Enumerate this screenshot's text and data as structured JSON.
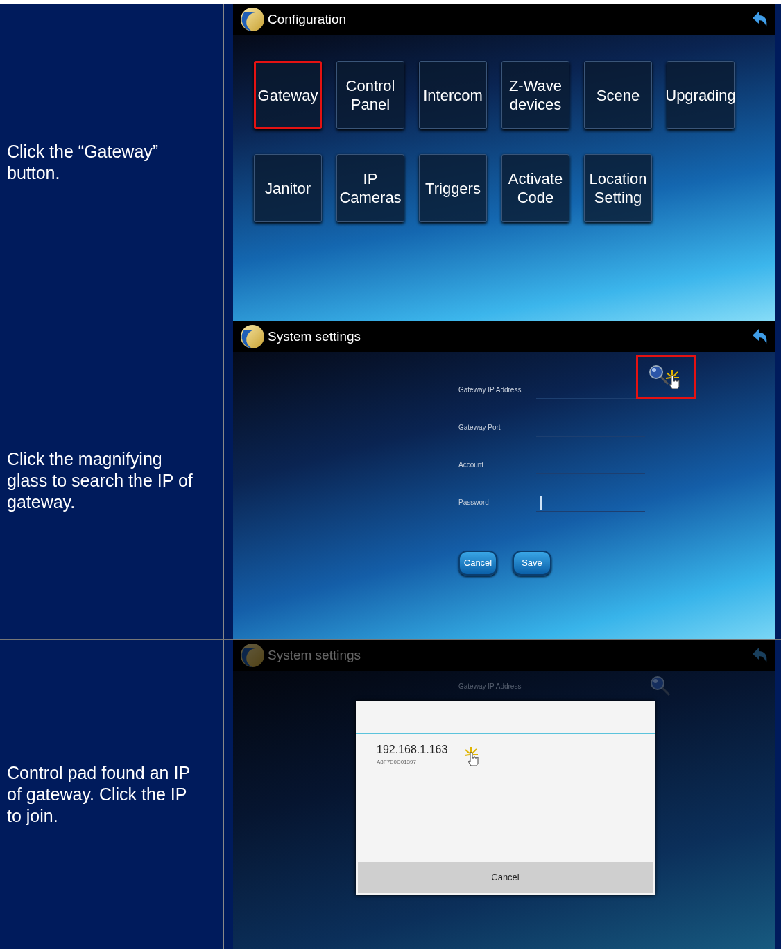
{
  "steps": [
    {
      "instruction": "Click the “Gateway” button.",
      "screen": {
        "kind": "configuration",
        "title": "Configuration",
        "dimmed": false,
        "tiles": [
          {
            "label": "Gateway",
            "highlighted": true
          },
          {
            "label": "Control Panel",
            "highlighted": false
          },
          {
            "label": "Intercom",
            "highlighted": false
          },
          {
            "label": "Z-Wave devices",
            "highlighted": false
          },
          {
            "label": "Scene",
            "highlighted": false
          },
          {
            "label": "Upgrading",
            "highlighted": false
          },
          {
            "label": "Janitor",
            "highlighted": false
          },
          {
            "label": "IP Cameras",
            "highlighted": false
          },
          {
            "label": "Triggers",
            "highlighted": false
          },
          {
            "label": "Activate Code",
            "highlighted": false
          },
          {
            "label": "Location Setting",
            "highlighted": false
          }
        ]
      }
    },
    {
      "instruction": "Click the magnifying glass to search the IP of gateway.",
      "screen": {
        "kind": "settings",
        "title": "System settings",
        "dimmed": false,
        "search_highlighted": true,
        "fields": [
          {
            "label": "Gateway IP Address",
            "focused": false
          },
          {
            "label": "Gateway Port",
            "focused": false
          },
          {
            "label": "Account",
            "focused": false
          },
          {
            "label": "Password",
            "focused": true
          }
        ],
        "buttons": [
          "Cancel",
          "Save"
        ]
      }
    },
    {
      "instruction": "Control pad found an IP of gateway. Click the IP to join.",
      "screen": {
        "kind": "search_results",
        "title": "System settings",
        "dimmed": true,
        "field_label": "Gateway IP Address",
        "results": [
          {
            "ip": "192.168.1.163",
            "id": "A8F7E0C01397"
          }
        ],
        "dialog_button": "Cancel"
      }
    }
  ]
}
